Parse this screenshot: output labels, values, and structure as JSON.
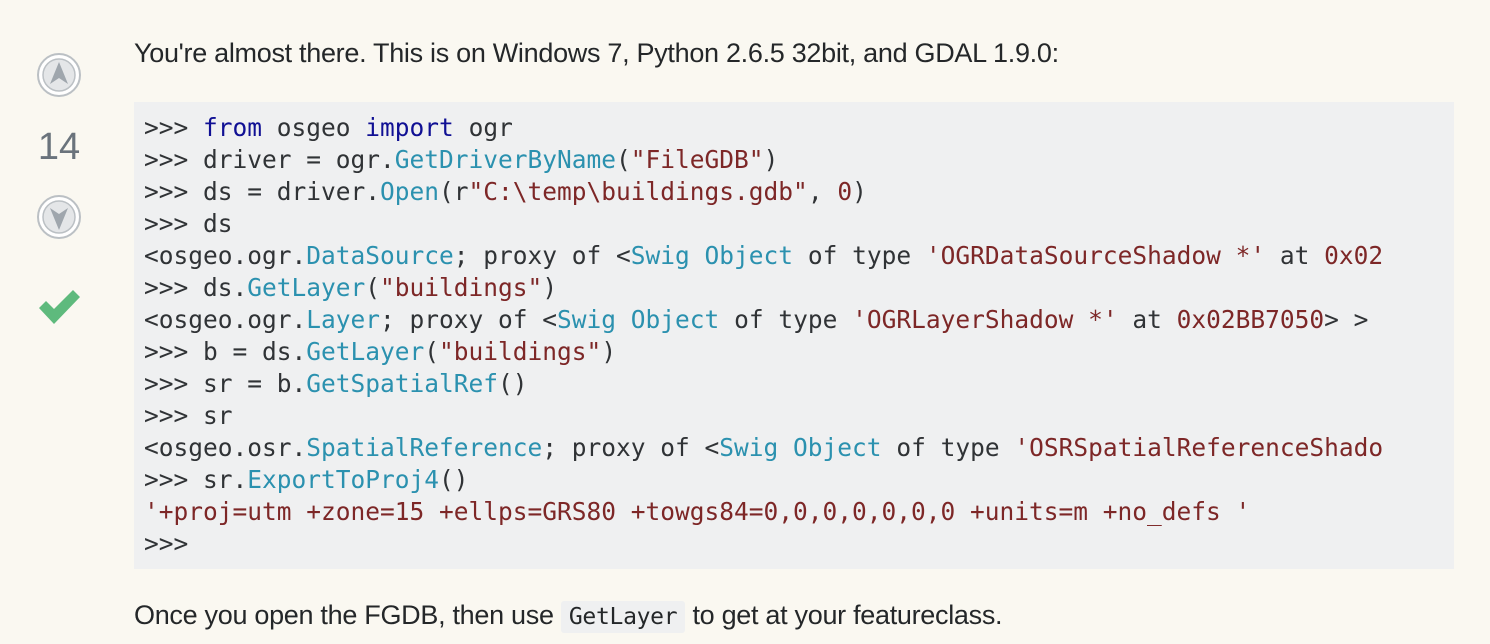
{
  "vote": {
    "count": "14"
  },
  "post": {
    "intro": "You're almost there. This is on Windows 7, Python 2.6.5 32bit, and GDAL 1.9.0:",
    "outro_before": "Once you open the FGDB, then use ",
    "outro_code": "GetLayer",
    "outro_after": " to get at your featureclass."
  },
  "code": {
    "lines": [
      [
        {
          "t": ">>> ",
          "c": ""
        },
        {
          "t": "from",
          "c": "kw"
        },
        {
          "t": " osgeo ",
          "c": ""
        },
        {
          "t": "import",
          "c": "kw"
        },
        {
          "t": " ogr",
          "c": ""
        }
      ],
      [
        {
          "t": ">>> driver = ogr.",
          "c": ""
        },
        {
          "t": "GetDriverByName",
          "c": "fn"
        },
        {
          "t": "(",
          "c": ""
        },
        {
          "t": "\"FileGDB\"",
          "c": "str"
        },
        {
          "t": ")",
          "c": ""
        }
      ],
      [
        {
          "t": ">>> ds = driver.",
          "c": ""
        },
        {
          "t": "Open",
          "c": "fn"
        },
        {
          "t": "(r",
          "c": ""
        },
        {
          "t": "\"C:\\temp\\buildings.gdb\"",
          "c": "str"
        },
        {
          "t": ", ",
          "c": ""
        },
        {
          "t": "0",
          "c": "num"
        },
        {
          "t": ")",
          "c": ""
        }
      ],
      [
        {
          "t": ">>> ds",
          "c": ""
        }
      ],
      [
        {
          "t": "<osgeo.ogr.",
          "c": ""
        },
        {
          "t": "DataSource",
          "c": "fn"
        },
        {
          "t": "; proxy of <",
          "c": ""
        },
        {
          "t": "Swig Object",
          "c": "fn"
        },
        {
          "t": " of type ",
          "c": ""
        },
        {
          "t": "'OGRDataSourceShadow *'",
          "c": "str"
        },
        {
          "t": " at ",
          "c": ""
        },
        {
          "t": "0x02",
          "c": "num"
        }
      ],
      [
        {
          "t": ">>> ds.",
          "c": ""
        },
        {
          "t": "GetLayer",
          "c": "fn"
        },
        {
          "t": "(",
          "c": ""
        },
        {
          "t": "\"buildings\"",
          "c": "str"
        },
        {
          "t": ")",
          "c": ""
        }
      ],
      [
        {
          "t": "<osgeo.ogr.",
          "c": ""
        },
        {
          "t": "Layer",
          "c": "fn"
        },
        {
          "t": "; proxy of <",
          "c": ""
        },
        {
          "t": "Swig Object",
          "c": "fn"
        },
        {
          "t": " of type ",
          "c": ""
        },
        {
          "t": "'OGRLayerShadow *'",
          "c": "str"
        },
        {
          "t": " at ",
          "c": ""
        },
        {
          "t": "0x02BB7050",
          "c": "num"
        },
        {
          "t": "> >",
          "c": ""
        }
      ],
      [
        {
          "t": ">>> b = ds.",
          "c": ""
        },
        {
          "t": "GetLayer",
          "c": "fn"
        },
        {
          "t": "(",
          "c": ""
        },
        {
          "t": "\"buildings\"",
          "c": "str"
        },
        {
          "t": ")",
          "c": ""
        }
      ],
      [
        {
          "t": ">>> sr = b.",
          "c": ""
        },
        {
          "t": "GetSpatialRef",
          "c": "fn"
        },
        {
          "t": "()",
          "c": ""
        }
      ],
      [
        {
          "t": ">>> sr",
          "c": ""
        }
      ],
      [
        {
          "t": "<osgeo.osr.",
          "c": ""
        },
        {
          "t": "SpatialReference",
          "c": "fn"
        },
        {
          "t": "; proxy of <",
          "c": ""
        },
        {
          "t": "Swig Object",
          "c": "fn"
        },
        {
          "t": " of type ",
          "c": ""
        },
        {
          "t": "'OSRSpatialReferenceShado",
          "c": "str"
        }
      ],
      [
        {
          "t": ">>> sr.",
          "c": ""
        },
        {
          "t": "ExportToProj4",
          "c": "fn"
        },
        {
          "t": "()",
          "c": ""
        }
      ],
      [
        {
          "t": "'+proj=utm +zone=15 +ellps=GRS80 +towgs84=0,0,0,0,0,0,0 +units=m +no_defs '",
          "c": "str"
        }
      ],
      [
        {
          "t": ">>>",
          "c": ""
        }
      ]
    ]
  },
  "icons": {
    "upvote": "arrow-up-circle-icon",
    "downvote": "arrow-down-circle-icon",
    "accepted": "checkmark-icon"
  },
  "colors": {
    "background": "#faf8f1",
    "code_background": "#eff0f1",
    "keyword": "#101094",
    "function": "#2b91af",
    "string": "#7d2727",
    "accepted": "#5eba7d",
    "vote_icon": "#bbc0c4"
  }
}
